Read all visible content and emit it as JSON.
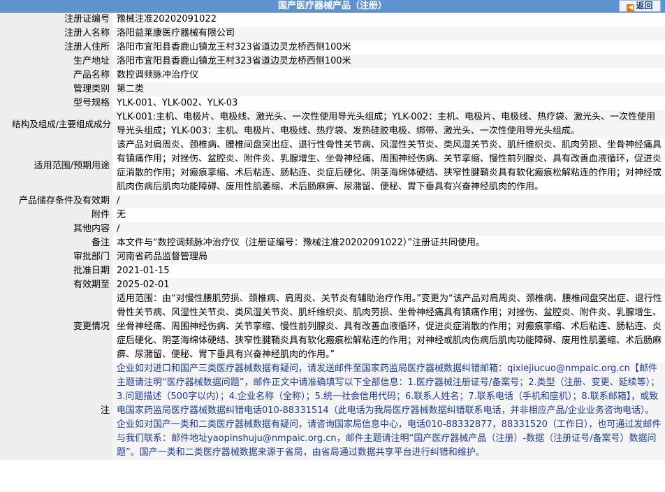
{
  "header": {
    "title": "国产医疗器械产品（注册）",
    "back_label": "返回"
  },
  "rows": [
    {
      "label": "注册证编号",
      "value": "豫械注准20202091022"
    },
    {
      "label": "注册人名称",
      "value": "洛阳益莱康医疗器械有限公司"
    },
    {
      "label": "注册人住所",
      "value": "洛阳市宜阳县香鹿山镇龙王村323省道边灵龙桥西侧100米"
    },
    {
      "label": "生产地址",
      "value": "洛阳市宜阳县香鹿山镇龙王村323省道边灵龙桥西侧100米"
    },
    {
      "label": "产品名称",
      "value": "数控调频脉冲治疗仪"
    },
    {
      "label": "管理类别",
      "value": "第二类"
    },
    {
      "label": "型号规格",
      "value": "YLK-001、YLK-002、YLK-03"
    },
    {
      "label": "结构及组成/主要组成成分",
      "value": "YLK-001:主机、电极片、电极线、激光头、一次性使用导光头组成；YLK-002：主机、电极片、电极线、热疗袋、激光头、一次性使用导光头组成；YLK-003：主机、电极片、电极线、热疗袋、发热硅胶电极、绑带、激光头、一次性使用导光头组成。"
    },
    {
      "label": "适用范围/预期用途",
      "value": "该产品对肩周炎、颈椎病、腰椎间盘突出症、退行性骨性关节病、风湿性关节炎、类风湿关节炎、肌纤维织炎、肌肉劳损、坐骨神经痛具有镇痛作用；对挫伤、盆腔炎、附件炎、乳腺增生、坐骨神经痛、周围神经伤病、关节挛缩、慢性前列腺炎、具有改善血液循环，促进炎症消散的作用；对瘢痕挛缩、术后粘连、肠粘连、炎症后硬化、阴茎海绵体硬结、狭窄性腱鞘炎具有软化瘢痕松解粘连的作用；对神经或肌肉伤病后肌肉功能障碍、废用性肌萎缩、术后肠麻痹、尿潴留、便秘、胃下垂具有兴奋神经肌肉的作用。"
    },
    {
      "label": "产品储存条件及有效期",
      "value": "/"
    },
    {
      "label": "附件",
      "value": "无"
    },
    {
      "label": "其他内容",
      "value": "/"
    },
    {
      "label": "备注",
      "value": "本文件与“数控调频脉冲治疗仪（注册证编号：豫械注准20202091022）”注册证共同使用。"
    },
    {
      "label": "审批部门",
      "value": "河南省药品监督管理局"
    },
    {
      "label": "批准日期",
      "value": "2021-01-15"
    },
    {
      "label": "有效期至",
      "value": "2025-02-01"
    },
    {
      "label": "变更情况",
      "value": "适用范围：由“对慢性腰肌劳损、颈椎病、肩周炎、关节炎有辅助治疗作用。”变更为“该产品对肩周炎、颈椎病、腰椎间盘突出症、退行性骨性关节病、风湿性关节炎、类风湿关节炎、肌纤维织炎、肌肉劳损、坐骨神经痛具有镇痛作用；对挫伤、盆腔炎、附件炎、乳腺增生、坐骨神经痛、周围神经伤病、关节挛缩、慢性前列腺炎、具有改善血液循环，促进炎症消散的作用；对瘢痕挛缩、术后粘连、肠粘连、炎症后硬化、阴茎海绵体硬结、狭窄性腱鞘炎具有软化瘢痕松解粘连的作用；对神经或肌肉伤病后肌肉功能障碍、废用性肌萎缩、术后肠麻痹、尿潴留、便秘、胃下垂具有兴奋神经肌肉的作用。”"
    },
    {
      "label": "注",
      "value": "企业如对进口和国产三类医疗器械数据有疑问，请发送邮件至国家药监局医疗器械数据纠错邮箱：qixiejiucuo@nmpaic.org.cn【邮件主题请注明“医疗器械数据问题”，邮件正文中请准确填写以下全部信息：1.医疗器械注册证号/备案号；2.类型（注册、变更、延续等）；3.问题描述（500字以内）；4.企业名称（全称）；5.统一社会信用代码；6.联系人姓名；7.联系电话（手机和座机）；8.联系邮箱】，或致电国家药监局医疗器械数据纠错电话010-88331514（此电话为我局医疗器械数据纠错联系电话，并非相应产品/企业业务咨询电话）。企业如对国产一类和二类医疗器械数据有疑问，请咨询国家局信息中心，电话010-88332877，88331520（工作日），也可通过发邮件与我们联系：邮件地址yaopinshuju@nmpaic.org.cn，邮件主题请注明“国产医疗器械产品（注册）-数据（注册证号/备案号）数据问题”。国产一类和二类医疗器械数据来源于省局，由省局通过数据共享平台进行纠错和维护。"
    }
  ]
}
